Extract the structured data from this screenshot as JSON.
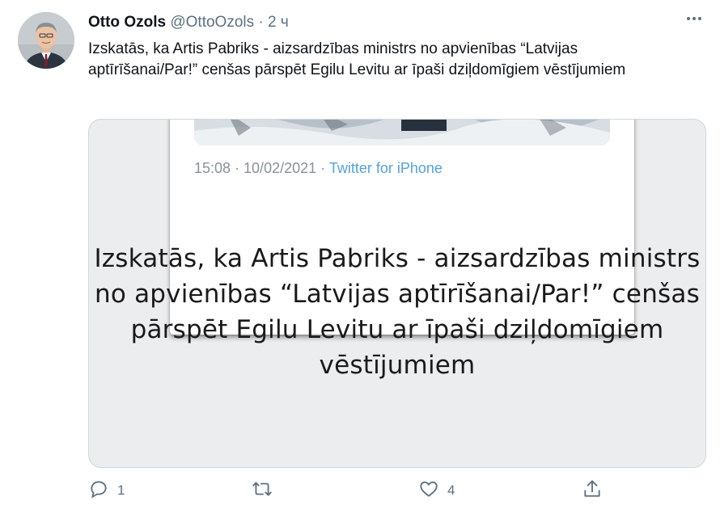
{
  "author": {
    "name": "Otto Ozols",
    "handle": "@OttoOzols",
    "separator": "·",
    "time": "2 ч"
  },
  "tweet_text": "Izskatās, ka Artis Pabriks - aizsardzības ministrs no apvienības “Latvijas aptīrīšanai/Par!” cenšas pārspēt Egilu Levitu ar īpaši dziļdomīgiem vēstījumiem",
  "media": {
    "embedded_card": {
      "timestamp": "15:08 · 10/02/2021 · ",
      "source": "Twitter for iPhone"
    },
    "quote_text": "Izskatās, ka Artis Pabriks - aizsardzības ministrs no apvienības “Latvijas aptīrīšanai/Par!” cenšas pārspēt Egilu Levitu ar īpaši dziļdomīgiem vēstījumiem"
  },
  "actions": {
    "reply_count": "1",
    "retweet_count": "",
    "like_count": "4"
  },
  "icons": {
    "more": "more-dots-icon",
    "reply": "reply-icon",
    "retweet": "retweet-icon",
    "like": "heart-icon",
    "share": "share-icon"
  },
  "colors": {
    "text_primary": "#0f1419",
    "text_secondary": "#5b7083",
    "link": "#56a1e0",
    "border": "#cfd9de"
  }
}
